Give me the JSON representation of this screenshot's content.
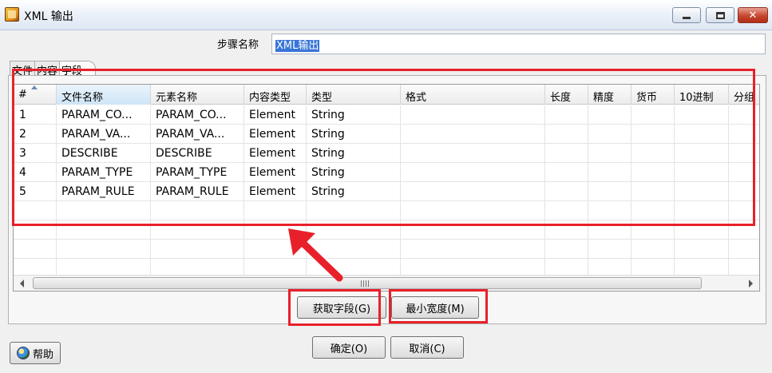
{
  "window": {
    "title": "XML 输出"
  },
  "step": {
    "label": "步骤名称",
    "value": "XML输出"
  },
  "tabs": [
    {
      "label": "文件"
    },
    {
      "label": "内容"
    },
    {
      "label": "字段"
    }
  ],
  "table": {
    "headers": [
      "#",
      "文件名称",
      "元素名称",
      "内容类型",
      "类型",
      "格式",
      "长度",
      "精度",
      "货币",
      "10进制",
      "分组"
    ],
    "rows": [
      [
        "1",
        "PARAM_CO...",
        "PARAM_CO...",
        "Element",
        "String",
        "",
        "",
        "",
        "",
        "",
        ""
      ],
      [
        "2",
        "PARAM_VA...",
        "PARAM_VA...",
        "Element",
        "String",
        "",
        "",
        "",
        "",
        "",
        ""
      ],
      [
        "3",
        "DESCRIBE",
        "DESCRIBE",
        "Element",
        "String",
        "",
        "",
        "",
        "",
        "",
        ""
      ],
      [
        "4",
        "PARAM_TYPE",
        "PARAM_TYPE",
        "Element",
        "String",
        "",
        "",
        "",
        "",
        "",
        ""
      ],
      [
        "5",
        "PARAM_RULE",
        "PARAM_RULE",
        "Element",
        "String",
        "",
        "",
        "",
        "",
        "",
        ""
      ],
      [
        "",
        "",
        "",
        "",
        "",
        "",
        "",
        "",
        "",
        "",
        ""
      ],
      [
        "",
        "",
        "",
        "",
        "",
        "",
        "",
        "",
        "",
        "",
        ""
      ],
      [
        "",
        "",
        "",
        "",
        "",
        "",
        "",
        "",
        "",
        "",
        ""
      ],
      [
        "",
        "",
        "",
        "",
        "",
        "",
        "",
        "",
        "",
        "",
        ""
      ]
    ]
  },
  "buttons": {
    "get_fields": "获取字段(G)",
    "min_width": "最小宽度(M)",
    "ok": "确定(O)",
    "cancel": "取消(C)",
    "help": "帮助"
  },
  "colors": {
    "annotation": "#e8202a",
    "selection": "#3875d7"
  }
}
